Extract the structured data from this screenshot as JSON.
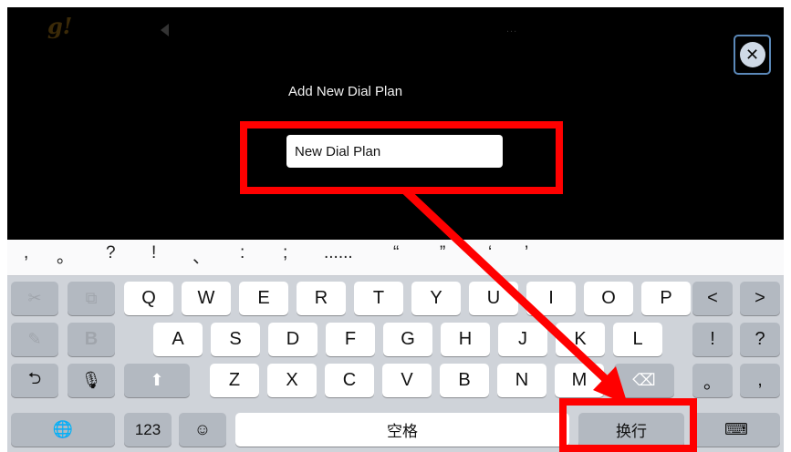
{
  "app": {
    "logo_text": "g!",
    "header_dots": "...",
    "back_icon": "chevron-left-icon",
    "close_icon": "close-circle-icon"
  },
  "dialog": {
    "title": "Add New Dial Plan",
    "input_value": "New Dial Plan",
    "input_placeholder": ""
  },
  "candidates": [
    ",",
    "。",
    "?",
    "!",
    "、",
    ":",
    ";",
    "......",
    "“",
    "”",
    "‘",
    "’"
  ],
  "keyboard": {
    "row1": [
      "Q",
      "W",
      "E",
      "R",
      "T",
      "Y",
      "U",
      "I",
      "O",
      "P"
    ],
    "row2": [
      "A",
      "S",
      "D",
      "F",
      "G",
      "H",
      "J",
      "K",
      "L"
    ],
    "row3": [
      "Z",
      "X",
      "C",
      "V",
      "B",
      "N",
      "M"
    ],
    "left_tools": {
      "cut_icon": "scissors-icon",
      "copy_icon": "copy-icon",
      "handwrite_icon": "pen-icon",
      "bold_label": "B",
      "undo_icon": "undo-icon",
      "mic_icon": "microphone-icon",
      "shift_icon": "shift-icon"
    },
    "right_keys": {
      "left_bracket": "<",
      "right_bracket": ">",
      "exclaim": "!",
      "question": "?",
      "period": "。",
      "comma": ",",
      "delete_icon": "delete-icon"
    },
    "bottom": {
      "globe_icon": "globe-icon",
      "num_label": "123",
      "emoji_icon": "emoji-icon",
      "space_label": "空格",
      "return_label": "换行",
      "dismiss_icon": "keyboard-dismiss-icon"
    }
  },
  "colors": {
    "highlight": "#ff0000",
    "close_border": "#5b88b8"
  }
}
